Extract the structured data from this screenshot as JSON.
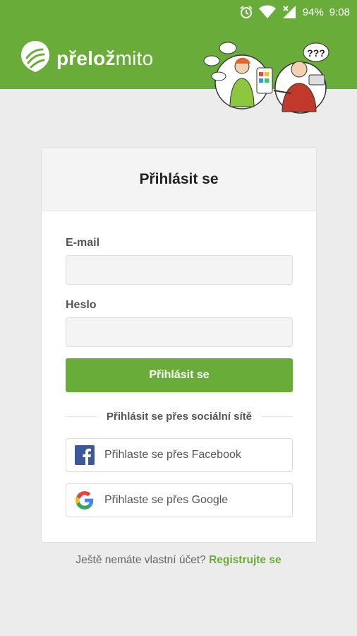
{
  "status_bar": {
    "battery": "94%",
    "time": "9:08"
  },
  "brand": {
    "name_bold": "přelož",
    "name_light": "mito"
  },
  "illustration": {
    "question_marks": "???"
  },
  "login": {
    "title": "Přihlásit se",
    "email_label": "E-mail",
    "email_value": "",
    "password_label": "Heslo",
    "password_value": "",
    "submit_label": "Přihlásit se",
    "social_divider": "Přihlásit se přes sociální sítě",
    "facebook_label": "Přihlaste se přes Facebook",
    "google_label": "Přihlaste se přes Google"
  },
  "footer": {
    "question": "Ještě nemáte vlastní účet?",
    "register_link": "Registrujte se"
  },
  "colors": {
    "brand_green": "#6aac3a",
    "facebook_blue": "#3b5998"
  }
}
